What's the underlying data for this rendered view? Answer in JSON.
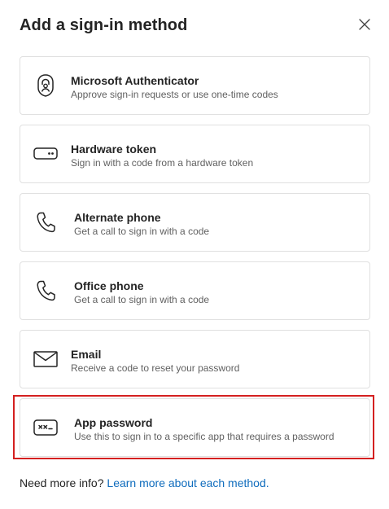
{
  "dialog": {
    "title": "Add a sign-in method",
    "close_icon": "close-icon"
  },
  "methods": [
    {
      "name": "Microsoft Authenticator",
      "description": "Approve sign-in requests or use one-time codes",
      "icon": "authenticator-lock-icon"
    },
    {
      "name": "Hardware token",
      "description": "Sign in with a code from a hardware token",
      "icon": "hardware-token-icon"
    },
    {
      "name": "Alternate phone",
      "description": "Get a call to sign in with a code",
      "icon": "phone-icon"
    },
    {
      "name": "Office phone",
      "description": "Get a call to sign in with a code",
      "icon": "phone-icon"
    },
    {
      "name": "Email",
      "description": "Receive a code to reset your password",
      "icon": "mail-icon"
    },
    {
      "name": "App password",
      "description": "Use this to sign in to a specific app that requires a password",
      "icon": "app-password-icon",
      "highlighted": true
    }
  ],
  "footer": {
    "prompt": "Need more info?",
    "link": "Learn more about each method."
  },
  "colors": {
    "highlight_border": "#d42020",
    "link": "#0f6cbd",
    "card_border": "#e0e0e0"
  }
}
